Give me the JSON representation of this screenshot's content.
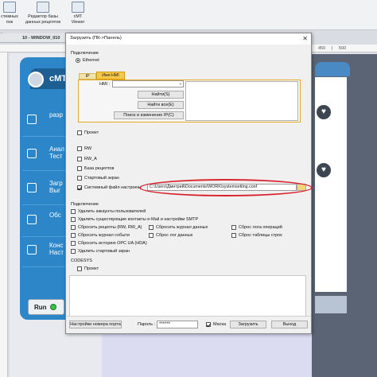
{
  "toolbar": {
    "items": [
      {
        "label": "стемных\nпок",
        "icon": "system-icon"
      },
      {
        "label": "Редактор базы\nданных рецептов",
        "icon": "database-icon"
      },
      {
        "label": "cMT\nViewer",
        "icon": "viewer-icon"
      }
    ]
  },
  "window_tab": "10 - WINDOW_010",
  "background": {
    "app_title": "cMT",
    "menu": [
      "разр",
      "Анал\nТест",
      "Загр\nВыг",
      "Обс",
      "Конс\nНаст"
    ],
    "run_label": "Run",
    "ruler_marks": "450     |     500"
  },
  "dialog": {
    "title": "Загрузить (ПК->Панель)",
    "connection_label": "Подключение",
    "ethernet_label": "Ethernet",
    "tab_ip": "IP",
    "tab_hmi": "Имя HMI",
    "hmi_label": "HMI :",
    "find_button": "Найти(S)",
    "find_all_button": "Найти все(E)",
    "search_ip_button": "Поиск и изменение IP(C)",
    "options": {
      "project": "Проект",
      "rw": "RW",
      "rw_a": "RW_A",
      "recipe_db": "База рецептов",
      "startup_window": "Стартовый экран",
      "system_settings": "Системный файл настроек"
    },
    "settings_path": "C:\\Users\\Дмитрий\\Documents\\WORK\\systemsetting.conf",
    "connection2_label": "Подключение",
    "remove_accounts": "Удалить аккаунты пользователей",
    "remove_contacts": "Удалить существующие контакты e-Mail и настройки SMTP",
    "reset_recipes": "Сбросить рецепты (RW, RW_A)",
    "reset_events": "Сбросить журнал событи",
    "reset_opcua": "Сбросить историю OPC UA (HDA)",
    "remove_startup": "Удалить стартовый экран",
    "reset_data_log": "Сбросить журнал данных",
    "reset_log_files": "Сброс лог данных",
    "reset_op_log": "Сброс лога операций",
    "reset_table_rows": "Сброс таблицы строк",
    "codesys_label": "CODESYS",
    "codesys_project": "Проект",
    "port_settings_button": "Настройки номера порта",
    "password_label": "Пароль :",
    "password_value": "******",
    "mask_label": "Маска",
    "download_button": "Загрузить",
    "exit_button": "Выход"
  },
  "colors": {
    "accent_tab": "#f7c94a",
    "highlight_oval": "#d9202a",
    "cmt_blue": "#2d86c8"
  }
}
